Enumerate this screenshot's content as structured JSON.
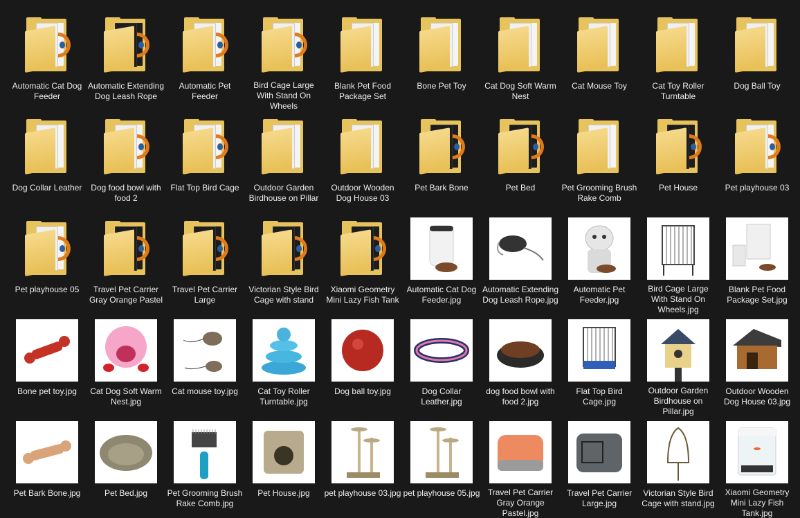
{
  "folders": [
    {
      "label": "Automatic Cat Dog Feeder",
      "style": "render"
    },
    {
      "label": "Automatic Extending Dog Leash Rope",
      "style": "render-dark"
    },
    {
      "label": "Automatic Pet Feeder",
      "style": "render"
    },
    {
      "label": "Bird Cage Large With Stand On Wheels",
      "style": "render-blue"
    },
    {
      "label": "Blank Pet Food Package Set",
      "style": "mtl"
    },
    {
      "label": "Bone Pet Toy",
      "style": "mtl"
    },
    {
      "label": "Cat Dog Soft Warm Nest",
      "style": "mtl"
    },
    {
      "label": "Cat Mouse Toy",
      "style": "mtl"
    },
    {
      "label": "Cat Toy Roller Turntable",
      "style": "mtl"
    },
    {
      "label": "Dog Ball Toy",
      "style": "mtl"
    },
    {
      "label": "Dog Collar Leather",
      "style": "mtl"
    },
    {
      "label": "Dog food bowl with food 2",
      "style": "cube"
    },
    {
      "label": "Flat Top Bird Cage",
      "style": "render-blue"
    },
    {
      "label": "Outdoor Garden Birdhouse on Pillar",
      "style": "mtl"
    },
    {
      "label": "Outdoor Wooden Dog House 03",
      "style": "mtl"
    },
    {
      "label": "Pet Bark Bone",
      "style": "cube-dark"
    },
    {
      "label": "Pet Bed",
      "style": "cube-dark"
    },
    {
      "label": "Pet Grooming Brush Rake Comb",
      "style": "mtl"
    },
    {
      "label": "Pet House",
      "style": "cube-dark"
    },
    {
      "label": "Pet playhouse 03",
      "style": "cube"
    },
    {
      "label": "Pet playhouse 05",
      "style": "cube"
    },
    {
      "label": "Travel Pet Carrier Gray Orange Pastel",
      "style": "cube-dark"
    },
    {
      "label": "Travel Pet Carrier Large",
      "style": "cube-dark"
    },
    {
      "label": "Victorian Style Bird Cage with stand",
      "style": "render-dark"
    },
    {
      "label": "Xiaomi Geometry Mini Lazy Fish Tank",
      "style": "render-dark"
    }
  ],
  "images": [
    {
      "label": "Automatic Cat Dog Feeder.jpg",
      "icon": "feeder-photo"
    },
    {
      "label": "Automatic Extending Dog Leash Rope.jpg",
      "icon": "leash-photo"
    },
    {
      "label": "Automatic Pet Feeder.jpg",
      "icon": "robot-feeder-photo"
    },
    {
      "label": "Bird Cage Large With Stand On Wheels.jpg",
      "icon": "bird-cage-photo"
    },
    {
      "label": "Blank Pet Food Package Set.jpg",
      "icon": "package-photo"
    },
    {
      "label": "Bone pet toy.jpg",
      "icon": "red-bone-photo"
    },
    {
      "label": "Cat Dog Soft Warm Nest.jpg",
      "icon": "pink-nest-photo"
    },
    {
      "label": "Cat mouse toy.jpg",
      "icon": "mouse-toy-photo"
    },
    {
      "label": "Cat Toy Roller Turntable.jpg",
      "icon": "turntable-photo"
    },
    {
      "label": "Dog ball toy.jpg",
      "icon": "ball-photo"
    },
    {
      "label": "Dog Collar Leather.jpg",
      "icon": "collar-photo"
    },
    {
      "label": "dog food bowl with food 2.jpg",
      "icon": "bowl-photo"
    },
    {
      "label": "Flat Top Bird Cage.jpg",
      "icon": "flat-cage-photo"
    },
    {
      "label": "Outdoor Garden Birdhouse on Pillar.jpg",
      "icon": "birdhouse-photo"
    },
    {
      "label": "Outdoor Wooden Dog House 03.jpg",
      "icon": "doghouse-photo"
    },
    {
      "label": "Pet Bark Bone.jpg",
      "icon": "beige-bone-photo"
    },
    {
      "label": "Pet Bed.jpg",
      "icon": "pet-bed-photo"
    },
    {
      "label": "Pet Grooming Brush Rake Comb.jpg",
      "icon": "comb-photo"
    },
    {
      "label": "Pet House.jpg",
      "icon": "pet-house-photo"
    },
    {
      "label": "pet playhouse 03.jpg",
      "icon": "playhouse-photo"
    },
    {
      "label": "pet playhouse 05.jpg",
      "icon": "playhouse-photo"
    },
    {
      "label": "Travel Pet Carrier Gray Orange Pastel.jpg",
      "icon": "orange-carrier-photo"
    },
    {
      "label": "Travel Pet Carrier Large.jpg",
      "icon": "gray-carrier-photo"
    },
    {
      "label": "Victorian Style Bird Cage with stand.jpg",
      "icon": "victorian-cage-photo"
    },
    {
      "label": "Xiaomi Geometry Mini Lazy Fish Tank.jpg",
      "icon": "fish-tank-photo"
    }
  ],
  "colors": {
    "background": "#191919",
    "folder": "#e6c35c",
    "text": "#ececec"
  }
}
